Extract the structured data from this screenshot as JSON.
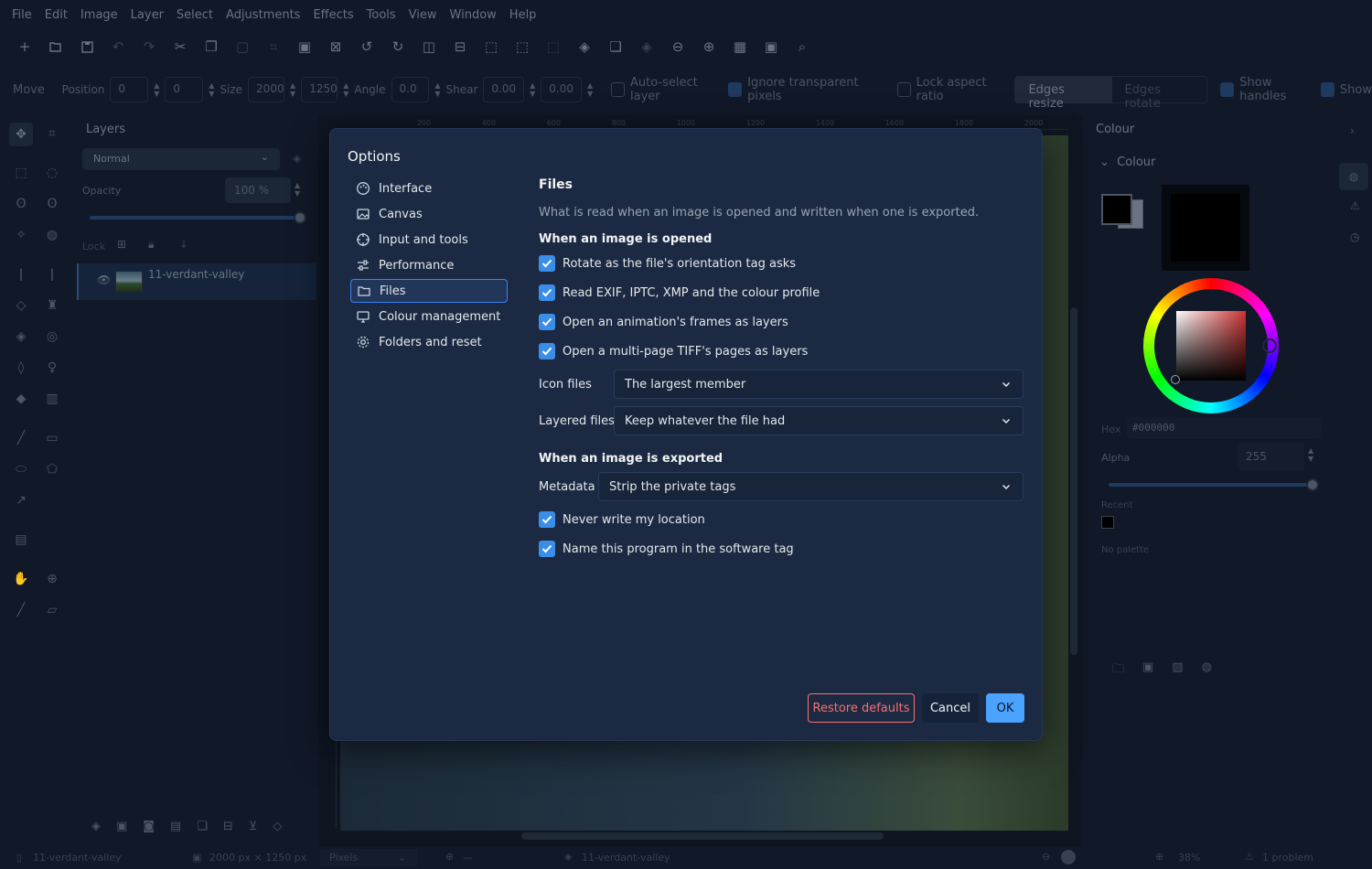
{
  "menubar": [
    "File",
    "Edit",
    "Image",
    "Layer",
    "Select",
    "Adjustments",
    "Effects",
    "Tools",
    "View",
    "Window",
    "Help"
  ],
  "options_bar": {
    "tool_name": "Move",
    "position_label": "Position",
    "position_x": "0",
    "position_y": "0",
    "size_label": "Size",
    "size_w": "2000",
    "size_h": "1250",
    "angle_label": "Angle",
    "angle": "0.0",
    "shear_label": "Shear",
    "shear_x": "0.00",
    "shear_y": "0.00",
    "auto_select": "Auto-select layer",
    "ignore_transparent": "Ignore transparent pixels",
    "lock_aspect": "Lock aspect ratio",
    "edges_resize": "Edges resize",
    "edges_rotate": "Edges rotate",
    "show_handles": "Show handles",
    "show_clip": "Show"
  },
  "layers_panel": {
    "title": "Layers",
    "blend_mode": "Normal",
    "opacity_label": "Opacity",
    "opacity_value": "100 %",
    "opacity_fraction": 1.0,
    "lock_label": "Lock",
    "layer_name": "11-verdant-valley"
  },
  "ruler_ticks": [
    "200",
    "400",
    "600",
    "800",
    "1000",
    "1200",
    "1400",
    "1600",
    "1800",
    "2000"
  ],
  "colour_panel": {
    "title": "Colour",
    "section": "Colour",
    "hex_label": "Hex",
    "hex_value": "#000000",
    "alpha_label": "Alpha",
    "alpha_value": "255",
    "recent_label": "Recent",
    "palette_label": "No palette"
  },
  "status_bar": {
    "document": "11-verdant-valley",
    "dimensions": "2000 px × 1250 px",
    "units": "Pixels",
    "cursor": "—",
    "layer": "11-verdant-valley",
    "zoom": "38%",
    "problems": "1 problem"
  },
  "dialog": {
    "title": "Options",
    "nav": [
      {
        "label": "Interface",
        "icon": "palette-icon"
      },
      {
        "label": "Canvas",
        "icon": "image-icon"
      },
      {
        "label": "Input and tools",
        "icon": "crosshair-icon"
      },
      {
        "label": "Performance",
        "icon": "sliders-icon"
      },
      {
        "label": "Files",
        "icon": "folder-icon"
      },
      {
        "label": "Colour management",
        "icon": "monitor-icon"
      },
      {
        "label": "Folders and reset",
        "icon": "gear-icon"
      }
    ],
    "active_nav": "Files",
    "heading": "Files",
    "description": "What is read when an image is opened and written when one is exported.",
    "opened_heading": "When an image is opened",
    "opened_options": [
      {
        "label": "Rotate as the file's orientation tag asks",
        "checked": true
      },
      {
        "label": "Read EXIF, IPTC, XMP and the colour profile",
        "checked": true
      },
      {
        "label": "Open an animation's frames as layers",
        "checked": true
      },
      {
        "label": "Open a multi-page TIFF's pages as layers",
        "checked": true
      }
    ],
    "icon_files_label": "Icon files",
    "icon_files_value": "The largest member",
    "layered_files_label": "Layered files",
    "layered_files_value": "Keep whatever the file had",
    "exported_heading": "When an image is exported",
    "metadata_label": "Metadata",
    "metadata_value": "Strip the private tags",
    "exported_options": [
      {
        "label": "Never write my location",
        "checked": true
      },
      {
        "label": "Name this program in the software tag",
        "checked": true
      }
    ],
    "restore_button": "Restore defaults",
    "cancel_button": "Cancel",
    "ok_button": "OK"
  },
  "colors": {
    "accent": "#3b8ee8",
    "danger": "#f87171",
    "dialog_bg": "#1b2a42",
    "app_bg": "#111827"
  }
}
